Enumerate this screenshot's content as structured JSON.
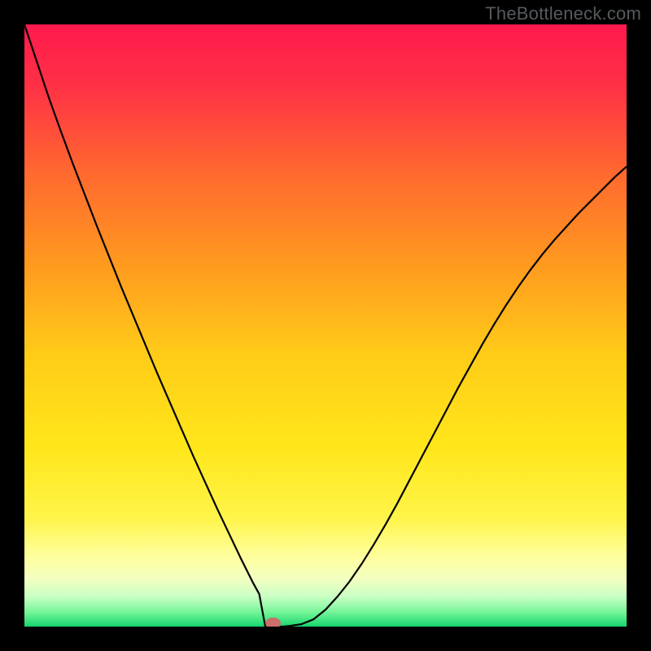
{
  "watermark": "TheBottleneck.com",
  "colors": {
    "frame": "#000000",
    "gradient_stops": [
      {
        "offset": 0.0,
        "color": "#ff1a4d"
      },
      {
        "offset": 0.1,
        "color": "#ff3046"
      },
      {
        "offset": 0.25,
        "color": "#ff6a2f"
      },
      {
        "offset": 0.4,
        "color": "#ff9a1f"
      },
      {
        "offset": 0.55,
        "color": "#ffcc18"
      },
      {
        "offset": 0.7,
        "color": "#ffe61a"
      },
      {
        "offset": 0.82,
        "color": "#fff44a"
      },
      {
        "offset": 0.88,
        "color": "#ffff9a"
      },
      {
        "offset": 0.92,
        "color": "#f4ffc0"
      },
      {
        "offset": 0.95,
        "color": "#caffc4"
      },
      {
        "offset": 0.975,
        "color": "#79f59a"
      },
      {
        "offset": 1.0,
        "color": "#17d66e"
      }
    ],
    "curve": "#000000",
    "marker_fill": "#cc6e6a",
    "marker_stroke": "#cc6e6a"
  },
  "chart_data": {
    "type": "line",
    "title": "",
    "xlabel": "",
    "ylabel": "",
    "xlim": [
      0,
      1
    ],
    "ylim": [
      0,
      1
    ],
    "x": [
      0.0,
      0.02,
      0.04,
      0.06,
      0.08,
      0.1,
      0.12,
      0.14,
      0.16,
      0.18,
      0.2,
      0.22,
      0.24,
      0.26,
      0.28,
      0.3,
      0.32,
      0.34,
      0.36,
      0.38,
      0.39,
      0.4,
      0.405,
      0.41,
      0.415,
      0.42,
      0.43,
      0.44,
      0.46,
      0.48,
      0.5,
      0.52,
      0.54,
      0.56,
      0.58,
      0.6,
      0.62,
      0.64,
      0.66,
      0.68,
      0.7,
      0.72,
      0.74,
      0.76,
      0.78,
      0.8,
      0.82,
      0.84,
      0.86,
      0.88,
      0.9,
      0.92,
      0.94,
      0.96,
      0.98,
      1.0
    ],
    "series": [
      {
        "name": "bottleneck-curve",
        "values": [
          1.0,
          0.94,
          0.88,
          0.824,
          0.77,
          0.718,
          0.666,
          0.616,
          0.566,
          0.518,
          0.47,
          0.422,
          0.376,
          0.33,
          0.284,
          0.24,
          0.196,
          0.154,
          0.112,
          0.072,
          0.054,
          0.036,
          0.028,
          0.02,
          0.014,
          0.01,
          0.005,
          0.001,
          0.004,
          0.012,
          0.028,
          0.05,
          0.075,
          0.104,
          0.136,
          0.17,
          0.206,
          0.244,
          0.282,
          0.32,
          0.358,
          0.396,
          0.432,
          0.468,
          0.502,
          0.534,
          0.564,
          0.592,
          0.618,
          0.642,
          0.664,
          0.686,
          0.706,
          0.726,
          0.746,
          0.764
        ]
      }
    ],
    "marker": {
      "x": 0.413,
      "y": 0.0,
      "rx": 0.012,
      "ry": 0.009
    },
    "flat_bottom": {
      "x_start": 0.395,
      "x_end": 0.43,
      "y": 0.0
    }
  }
}
